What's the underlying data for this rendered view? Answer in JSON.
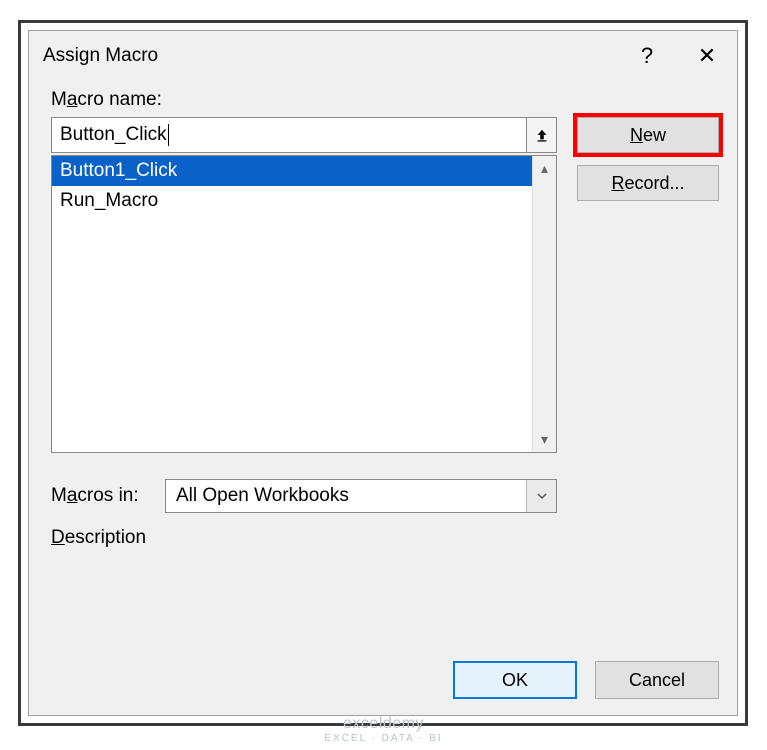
{
  "dialog": {
    "title": "Assign Macro",
    "help_label": "?",
    "close_label": "✕"
  },
  "macro_name": {
    "label_pre": "M",
    "label_u": "a",
    "label_post": "cro name:",
    "value": "Button_Click"
  },
  "macro_list": {
    "items": [
      "Button1_Click",
      "Run_Macro"
    ],
    "selected_index": 0
  },
  "buttons": {
    "new_pre": "",
    "new_u": "N",
    "new_post": "ew",
    "record_pre": "",
    "record_u": "R",
    "record_post": "ecord..."
  },
  "macros_in": {
    "label_pre": "M",
    "label_u": "a",
    "label_post": "cros in:",
    "value": "All Open Workbooks"
  },
  "description": {
    "label_pre": "",
    "label_u": "D",
    "label_post": "escription"
  },
  "footer": {
    "ok": "OK",
    "cancel": "Cancel"
  },
  "watermark": {
    "brand": "exceldemy",
    "sub": "EXCEL · DATA · BI"
  }
}
